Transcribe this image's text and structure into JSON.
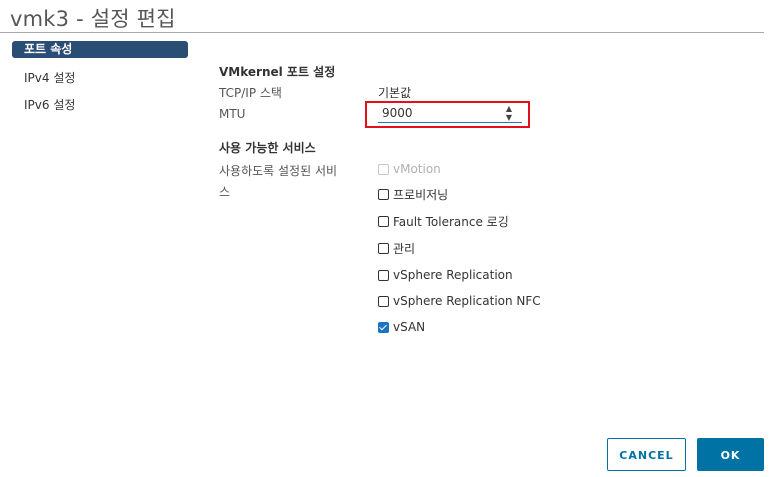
{
  "dialog": {
    "title": "vmk3 - 설정 편집"
  },
  "nav": {
    "items": [
      {
        "label": "포트 속성",
        "active": true
      },
      {
        "label": "IPv4 설정",
        "active": false
      },
      {
        "label": "IPv6 설정",
        "active": false
      }
    ]
  },
  "port_settings": {
    "section_title": "VMkernel 포트 설정",
    "tcpip_label": "TCP/IP 스택",
    "tcpip_value": "기본값",
    "mtu_label": "MTU",
    "mtu_value": "9000"
  },
  "services": {
    "section_title": "사용 가능한 서비스",
    "enabled_label_line1": "사용하도록 설정된 서비",
    "enabled_label_line2": "스",
    "items": [
      {
        "label": "vMotion",
        "checked": false,
        "disabled": true
      },
      {
        "label": "프로비저닝",
        "checked": false,
        "disabled": false
      },
      {
        "label": "Fault Tolerance 로깅",
        "checked": false,
        "disabled": false
      },
      {
        "label": "관리",
        "checked": false,
        "disabled": false
      },
      {
        "label": "vSphere Replication",
        "checked": false,
        "disabled": false
      },
      {
        "label": "vSphere Replication NFC",
        "checked": false,
        "disabled": false
      },
      {
        "label": "vSAN",
        "checked": true,
        "disabled": false
      }
    ]
  },
  "footer": {
    "cancel_label": "CANCEL",
    "ok_label": "OK"
  },
  "colors": {
    "nav_active_bg": "#2a4d75",
    "highlight_border": "#e2101c",
    "primary": "#0072a3",
    "checkbox_checked": "#1b74c2"
  }
}
